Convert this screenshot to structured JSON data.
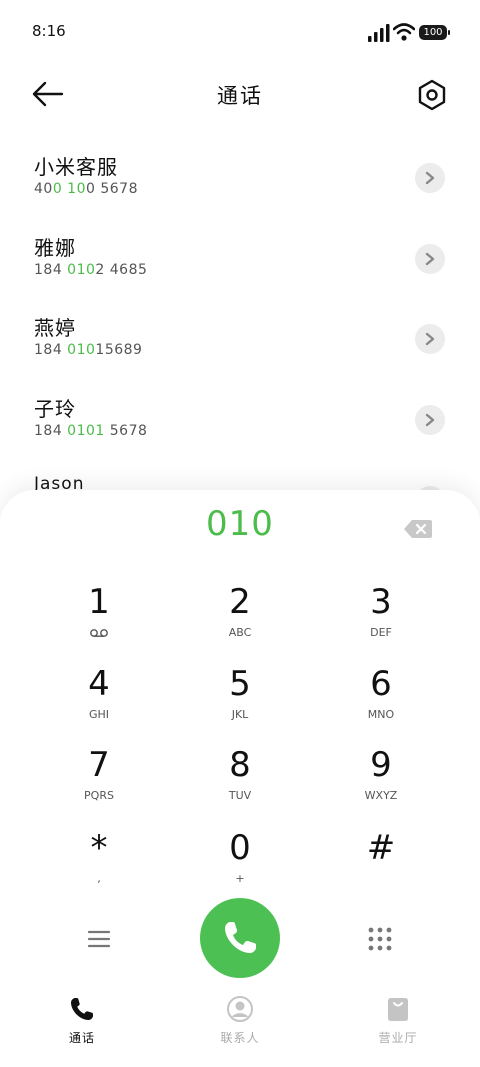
{
  "status": {
    "time": "8:16",
    "battery": "100"
  },
  "header": {
    "title": "通话"
  },
  "contacts": [
    {
      "name": "小米客服",
      "number_parts": [
        "40",
        "0 10",
        "0 5678"
      ]
    },
    {
      "name": "雅娜",
      "number_parts": [
        "184 ",
        "010",
        "2 4685"
      ]
    },
    {
      "name": "燕婷",
      "number_parts": [
        "184 ",
        "010",
        "15689"
      ]
    },
    {
      "name": "子玲",
      "number_parts": [
        "184 ",
        "0101",
        " 5678"
      ]
    },
    {
      "name": "Jason",
      "number_parts": [
        "",
        "",
        ""
      ]
    }
  ],
  "dialer": {
    "input": "010",
    "keys": [
      {
        "digit": "1",
        "sub": ""
      },
      {
        "digit": "2",
        "sub": "ABC"
      },
      {
        "digit": "3",
        "sub": "DEF"
      },
      {
        "digit": "4",
        "sub": "GHI"
      },
      {
        "digit": "5",
        "sub": "JKL"
      },
      {
        "digit": "6",
        "sub": "MNO"
      },
      {
        "digit": "7",
        "sub": "PQRS"
      },
      {
        "digit": "8",
        "sub": "TUV"
      },
      {
        "digit": "9",
        "sub": "WXYZ"
      },
      {
        "digit": "*",
        "sub": ","
      },
      {
        "digit": "0",
        "sub": "+"
      },
      {
        "digit": "#",
        "sub": ""
      }
    ]
  },
  "nav": [
    {
      "label": "通话",
      "icon": "phone-icon"
    },
    {
      "label": "联系人",
      "icon": "person-icon"
    },
    {
      "label": "营业厅",
      "icon": "shopping-bag-icon"
    }
  ],
  "colors": {
    "accent": "#4cbc4a",
    "call_button": "#4cc052"
  }
}
